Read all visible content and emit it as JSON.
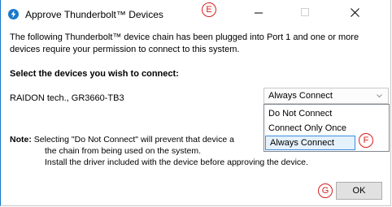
{
  "window": {
    "title": "Approve Thunderbolt™ Devices",
    "icon": "thunderbolt-icon",
    "controls": {
      "minimize": "minimize-icon",
      "maximize": "maximize-icon",
      "close": "close-icon"
    }
  },
  "markers": {
    "e": "E",
    "f": "F",
    "g": "G"
  },
  "content": {
    "description": "The following Thunderbolt™ device chain has been plugged into Port 1 and one or more devices require your permission to connect to this system.",
    "select_heading": "Select the devices you wish to connect:",
    "device_name": "RAIDON tech., GR3660-TB3",
    "connection_select": {
      "value": "Always Connect",
      "options": [
        "Do Not Connect",
        "Connect Only Once",
        "Always Connect"
      ],
      "highlighted": "Always Connect"
    },
    "note": {
      "label": "Note:",
      "line1": "Selecting \"Do Not Connect\" will prevent that device a",
      "line2": "the chain from being used on the system.",
      "line3": "Install the driver included with the device before approving the device."
    }
  },
  "buttons": {
    "ok": "OK"
  },
  "colors": {
    "accent": "#1979ca",
    "marker": "#d81e1e",
    "highlight": "#e5f1fb"
  }
}
